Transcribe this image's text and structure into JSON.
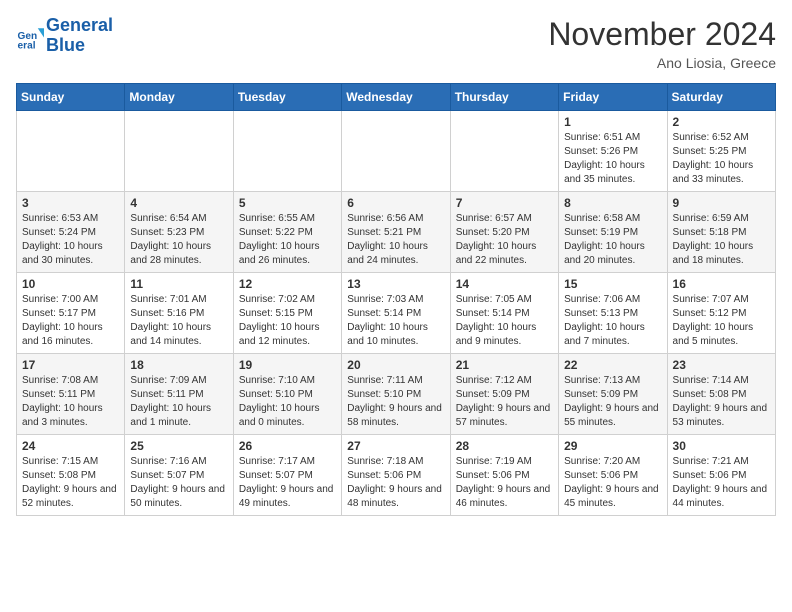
{
  "logo": {
    "line1": "General",
    "line2": "Blue"
  },
  "title": "November 2024",
  "location": "Ano Liosia, Greece",
  "days_header": [
    "Sunday",
    "Monday",
    "Tuesday",
    "Wednesday",
    "Thursday",
    "Friday",
    "Saturday"
  ],
  "weeks": [
    [
      {
        "day": "",
        "text": ""
      },
      {
        "day": "",
        "text": ""
      },
      {
        "day": "",
        "text": ""
      },
      {
        "day": "",
        "text": ""
      },
      {
        "day": "",
        "text": ""
      },
      {
        "day": "1",
        "text": "Sunrise: 6:51 AM\nSunset: 5:26 PM\nDaylight: 10 hours and 35 minutes."
      },
      {
        "day": "2",
        "text": "Sunrise: 6:52 AM\nSunset: 5:25 PM\nDaylight: 10 hours and 33 minutes."
      }
    ],
    [
      {
        "day": "3",
        "text": "Sunrise: 6:53 AM\nSunset: 5:24 PM\nDaylight: 10 hours and 30 minutes."
      },
      {
        "day": "4",
        "text": "Sunrise: 6:54 AM\nSunset: 5:23 PM\nDaylight: 10 hours and 28 minutes."
      },
      {
        "day": "5",
        "text": "Sunrise: 6:55 AM\nSunset: 5:22 PM\nDaylight: 10 hours and 26 minutes."
      },
      {
        "day": "6",
        "text": "Sunrise: 6:56 AM\nSunset: 5:21 PM\nDaylight: 10 hours and 24 minutes."
      },
      {
        "day": "7",
        "text": "Sunrise: 6:57 AM\nSunset: 5:20 PM\nDaylight: 10 hours and 22 minutes."
      },
      {
        "day": "8",
        "text": "Sunrise: 6:58 AM\nSunset: 5:19 PM\nDaylight: 10 hours and 20 minutes."
      },
      {
        "day": "9",
        "text": "Sunrise: 6:59 AM\nSunset: 5:18 PM\nDaylight: 10 hours and 18 minutes."
      }
    ],
    [
      {
        "day": "10",
        "text": "Sunrise: 7:00 AM\nSunset: 5:17 PM\nDaylight: 10 hours and 16 minutes."
      },
      {
        "day": "11",
        "text": "Sunrise: 7:01 AM\nSunset: 5:16 PM\nDaylight: 10 hours and 14 minutes."
      },
      {
        "day": "12",
        "text": "Sunrise: 7:02 AM\nSunset: 5:15 PM\nDaylight: 10 hours and 12 minutes."
      },
      {
        "day": "13",
        "text": "Sunrise: 7:03 AM\nSunset: 5:14 PM\nDaylight: 10 hours and 10 minutes."
      },
      {
        "day": "14",
        "text": "Sunrise: 7:05 AM\nSunset: 5:14 PM\nDaylight: 10 hours and 9 minutes."
      },
      {
        "day": "15",
        "text": "Sunrise: 7:06 AM\nSunset: 5:13 PM\nDaylight: 10 hours and 7 minutes."
      },
      {
        "day": "16",
        "text": "Sunrise: 7:07 AM\nSunset: 5:12 PM\nDaylight: 10 hours and 5 minutes."
      }
    ],
    [
      {
        "day": "17",
        "text": "Sunrise: 7:08 AM\nSunset: 5:11 PM\nDaylight: 10 hours and 3 minutes."
      },
      {
        "day": "18",
        "text": "Sunrise: 7:09 AM\nSunset: 5:11 PM\nDaylight: 10 hours and 1 minute."
      },
      {
        "day": "19",
        "text": "Sunrise: 7:10 AM\nSunset: 5:10 PM\nDaylight: 10 hours and 0 minutes."
      },
      {
        "day": "20",
        "text": "Sunrise: 7:11 AM\nSunset: 5:10 PM\nDaylight: 9 hours and 58 minutes."
      },
      {
        "day": "21",
        "text": "Sunrise: 7:12 AM\nSunset: 5:09 PM\nDaylight: 9 hours and 57 minutes."
      },
      {
        "day": "22",
        "text": "Sunrise: 7:13 AM\nSunset: 5:09 PM\nDaylight: 9 hours and 55 minutes."
      },
      {
        "day": "23",
        "text": "Sunrise: 7:14 AM\nSunset: 5:08 PM\nDaylight: 9 hours and 53 minutes."
      }
    ],
    [
      {
        "day": "24",
        "text": "Sunrise: 7:15 AM\nSunset: 5:08 PM\nDaylight: 9 hours and 52 minutes."
      },
      {
        "day": "25",
        "text": "Sunrise: 7:16 AM\nSunset: 5:07 PM\nDaylight: 9 hours and 50 minutes."
      },
      {
        "day": "26",
        "text": "Sunrise: 7:17 AM\nSunset: 5:07 PM\nDaylight: 9 hours and 49 minutes."
      },
      {
        "day": "27",
        "text": "Sunrise: 7:18 AM\nSunset: 5:06 PM\nDaylight: 9 hours and 48 minutes."
      },
      {
        "day": "28",
        "text": "Sunrise: 7:19 AM\nSunset: 5:06 PM\nDaylight: 9 hours and 46 minutes."
      },
      {
        "day": "29",
        "text": "Sunrise: 7:20 AM\nSunset: 5:06 PM\nDaylight: 9 hours and 45 minutes."
      },
      {
        "day": "30",
        "text": "Sunrise: 7:21 AM\nSunset: 5:06 PM\nDaylight: 9 hours and 44 minutes."
      }
    ]
  ]
}
